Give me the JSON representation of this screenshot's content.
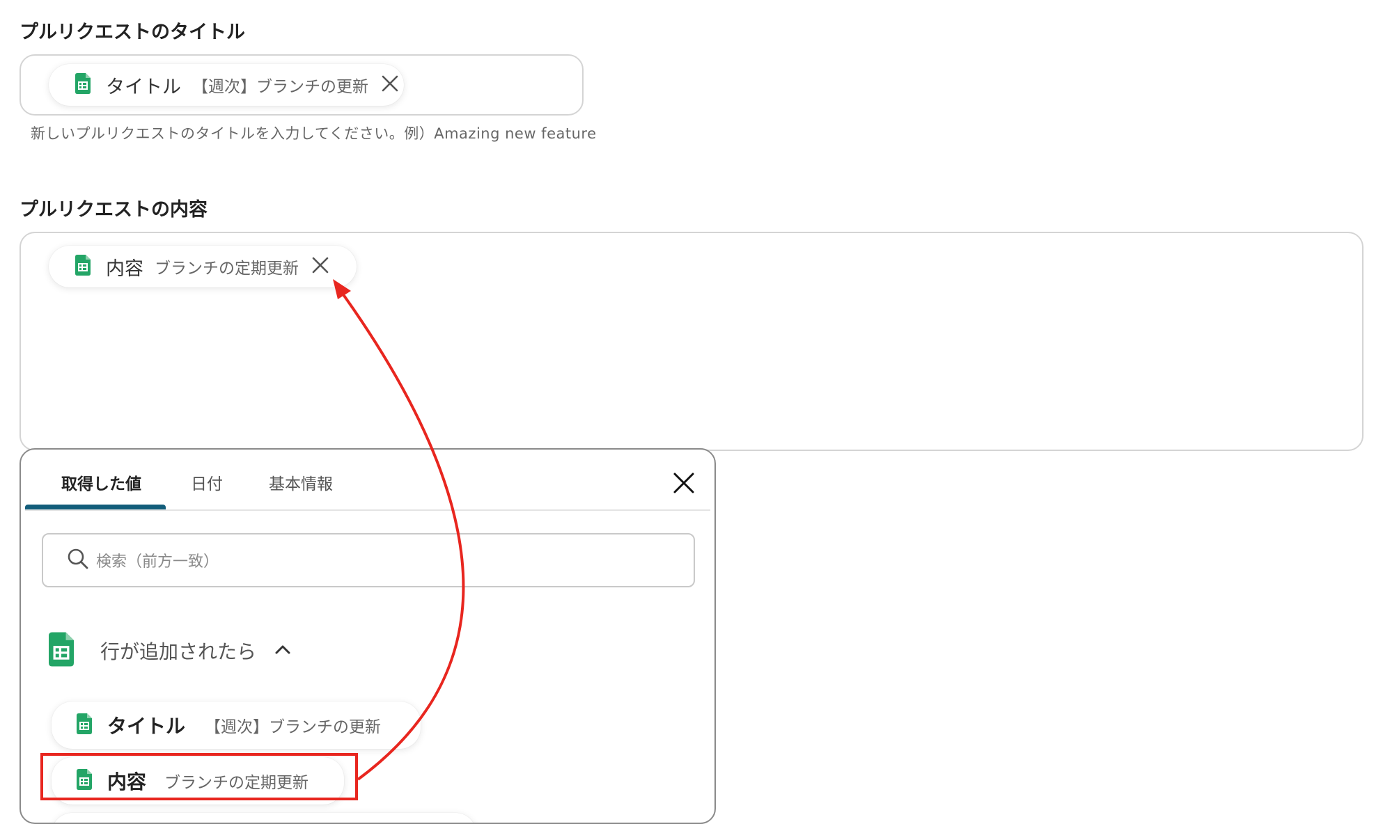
{
  "title_section": {
    "label": "プルリクエストのタイトル",
    "chip": {
      "name": "タイトル",
      "value": "【週次】ブランチの更新"
    },
    "hint": "新しいプルリクエストのタイトルを入力してください。例）Amazing new feature"
  },
  "content_section": {
    "label": "プルリクエストの内容",
    "chip": {
      "name": "内容",
      "value": "ブランチの定期更新"
    }
  },
  "picker": {
    "tabs": [
      {
        "label": "取得した値",
        "active": true
      },
      {
        "label": "日付",
        "active": false
      },
      {
        "label": "基本情報",
        "active": false
      }
    ],
    "search_placeholder": "検索（前方一致）",
    "group": {
      "title": "行が追加されたら",
      "items": [
        {
          "name": "タイトル",
          "value": "【週次】ブランチの更新"
        },
        {
          "name": "内容",
          "value": "ブランチの定期更新"
        }
      ]
    }
  },
  "colors": {
    "sheets_green": "#23a566",
    "tab_accent": "#125d7a",
    "annotation_red": "#e8261f"
  },
  "icons": [
    "google-sheets-icon",
    "close-icon",
    "search-icon",
    "chevron-up-icon"
  ]
}
